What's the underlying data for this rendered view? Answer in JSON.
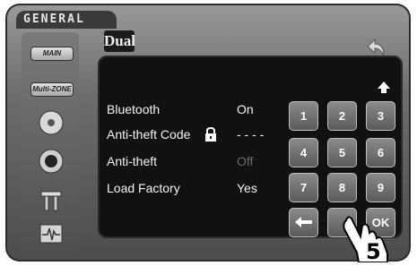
{
  "header": {
    "title": "GENERAL",
    "logo": "Dual",
    "back_icon": "back-arrow-icon"
  },
  "sidebar": {
    "main_label": "MAIN",
    "multizone_label": "Multi-ZONE",
    "icons": [
      "disc-icon",
      "speaker-icon",
      "tools-icon",
      "waveform-icon"
    ]
  },
  "settings": [
    {
      "label": "Bluetooth",
      "value": "On",
      "enabled": true
    },
    {
      "label": "Anti-theft  Code",
      "value": "- - - -",
      "enabled": true,
      "icon": "lock-icon"
    },
    {
      "label": "Anti-theft",
      "value": "Off",
      "enabled": false
    },
    {
      "label": "Load Factory",
      "value": "Yes",
      "enabled": true
    }
  ],
  "keypad": {
    "keys": [
      "1",
      "2",
      "3",
      "4",
      "5",
      "6",
      "7",
      "8",
      "9"
    ],
    "backspace_icon": "left-arrow-icon",
    "zero_key": "",
    "ok_label": "OK",
    "scroll_icon": "up-arrow-icon"
  },
  "step_callout": {
    "number": "5",
    "icon": "pointing-hand-icon"
  }
}
